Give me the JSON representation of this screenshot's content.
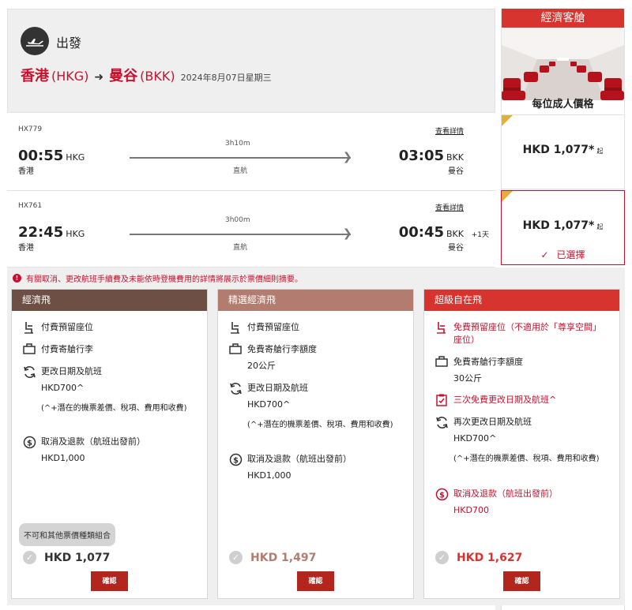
{
  "header": {
    "direction_label": "出發",
    "origin_city": "香港",
    "origin_code": "(HKG)",
    "dest_city": "曼谷",
    "dest_code": "(BKK)",
    "date": "2024年8月07日星期三"
  },
  "cabin": {
    "title": "經濟客艙",
    "price_label": "每位成人價格"
  },
  "flights": [
    {
      "number": "HX779",
      "details_link": "查看詳情",
      "dep_time": "00:55",
      "dep_code": "HKG",
      "dep_city": "香港",
      "duration": "3h10m",
      "stops": "直航",
      "arr_time": "03:05",
      "arr_code": "BKK",
      "arr_city": "曼谷",
      "price": "HKD 1,077*",
      "price_suffix": "起"
    },
    {
      "number": "HX761",
      "details_link": "查看詳情",
      "dep_time": "22:45",
      "dep_code": "HKG",
      "dep_city": "香港",
      "duration": "3h00m",
      "stops": "直航",
      "arr_time": "00:45",
      "arr_code": "BKK",
      "arr_city": "曼谷",
      "day_offset": "+1天",
      "price": "HKD 1,077*",
      "price_suffix": "起",
      "selected_label": "已選擇"
    }
  ],
  "notice": "有關取消、更改航班手續費及未能依時登機費用的詳情將展示於票價細則摘要。",
  "fares": [
    {
      "name": "經濟飛",
      "seat": "付費預留座位",
      "baggage": "付費寄艙行李",
      "change": "更改日期及航班",
      "change_fee": "HKD700^",
      "change_note": "(^+潛在的機票差價、稅項、費用和收費)",
      "refund": "取消及退款（航班出發前）",
      "refund_fee": "HKD1,000",
      "combo_note": "不可和其他票價種類組合",
      "total": "HKD 1,077",
      "confirm": "確認"
    },
    {
      "name": "精選經濟飛",
      "seat": "付費預留座位",
      "baggage": "免費寄艙行李額度",
      "baggage_allowance": "20公斤",
      "change": "更改日期及航班",
      "change_fee": "HKD700^",
      "change_note": "(^+潛在的機票差價、稅項、費用和收費)",
      "refund": "取消及退款（航班出發前）",
      "refund_fee": "HKD1,000",
      "total": "HKD 1,497",
      "confirm": "確認"
    },
    {
      "name": "超級自在飛",
      "seat": "免費預留座位（不適用於「尊享空間」座位）",
      "baggage": "免費寄艙行李額度",
      "baggage_allowance": "30公斤",
      "free_change": "三次免費更改日期及航班^",
      "change": "再次更改日期及航班",
      "change_fee": "HKD700^",
      "change_note": "(^+潛在的機票差價、稅項、費用和收費)",
      "refund": "取消及退款（航班出發前）",
      "refund_fee": "HKD700",
      "total": "HKD 1,627",
      "confirm": "確認"
    }
  ],
  "colors": {
    "brand_red": "#c8102e",
    "fare_economy": "#6e4f44",
    "fare_select": "#b37c70",
    "fare_flex": "#d8342f",
    "selected_corner": "#e0b03a"
  },
  "icons": [
    "plane-takeoff-icon",
    "arrow-right-icon",
    "seat-icon",
    "luggage-icon",
    "refresh-icon",
    "refund-icon",
    "checklist-icon",
    "check-icon",
    "alert-icon"
  ]
}
